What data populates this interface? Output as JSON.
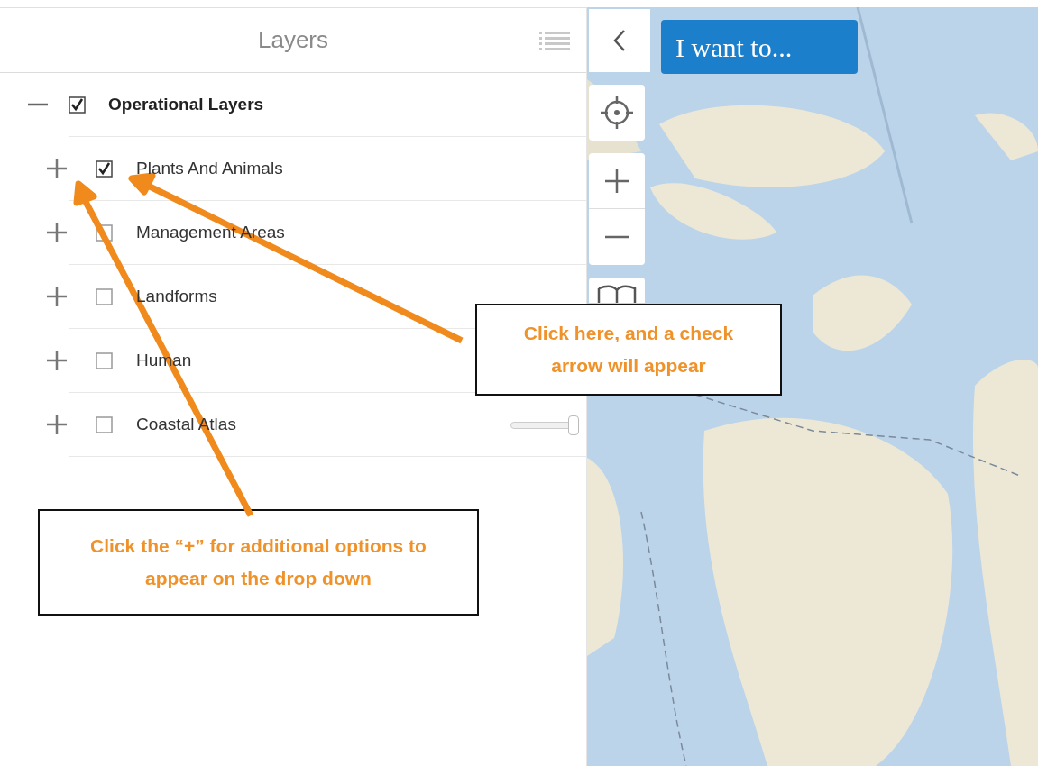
{
  "panel": {
    "title": "Layers"
  },
  "layers": [
    {
      "label": "Operational Layers",
      "checked": true,
      "expanded": true,
      "children": [
        {
          "label": "Plants And Animals",
          "checked": true,
          "expanded": false
        },
        {
          "label": "Management Areas",
          "checked": false,
          "expanded": false
        },
        {
          "label": "Landforms",
          "checked": false,
          "expanded": false
        },
        {
          "label": "Human",
          "checked": false,
          "expanded": false
        },
        {
          "label": "Coastal Atlas",
          "checked": false,
          "expanded": false,
          "level": 1
        }
      ]
    }
  ],
  "map": {
    "menu_button": "I want to..."
  },
  "callouts": [
    {
      "text": "Click here, and a check arrow will appear"
    },
    {
      "text": "Click the “+” for additional options to appear on the drop down"
    }
  ]
}
